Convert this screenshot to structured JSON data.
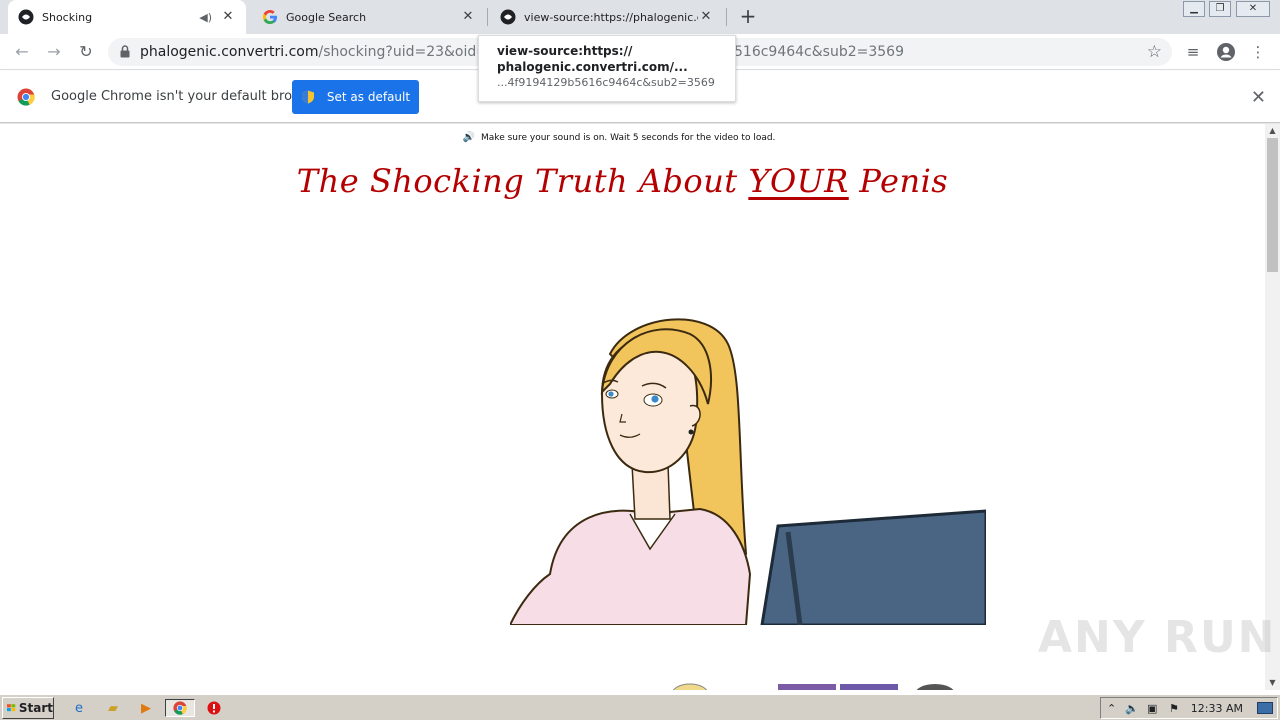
{
  "tabs": [
    {
      "title": "Shocking",
      "active": true,
      "muted_icon": "speaker-icon"
    },
    {
      "title": "Google Search",
      "active": false
    },
    {
      "title": "view-source:https://phalogenic.conv",
      "active": false
    }
  ],
  "omnibox": {
    "host": "phalogenic.convertri.com",
    "path": "/shocking?uid=23&oid=3&affi",
    "tail": "516c9464c&sub2=3569"
  },
  "tooltip": {
    "line1": "view-source:https://",
    "line2": "phalogenic.convertri.com/...",
    "line3": "...4f9194129b5616c9464c&sub2=3569"
  },
  "infobar": {
    "message": "Google Chrome isn't your default browser",
    "button": "Set as default"
  },
  "page": {
    "notice": "Make sure your sound is on. Wait 5 seconds for the video to load.",
    "headline_pre": "The Shocking Truth About ",
    "headline_em": "YOUR",
    "headline_post": " Penis"
  },
  "watermark": "ANY RUN",
  "taskbar": {
    "start": "Start",
    "clock": "12:33 AM"
  },
  "colors": {
    "headline": "#b40000",
    "accent_button": "#1a73e8",
    "tabstrip": "#dee1e6"
  }
}
